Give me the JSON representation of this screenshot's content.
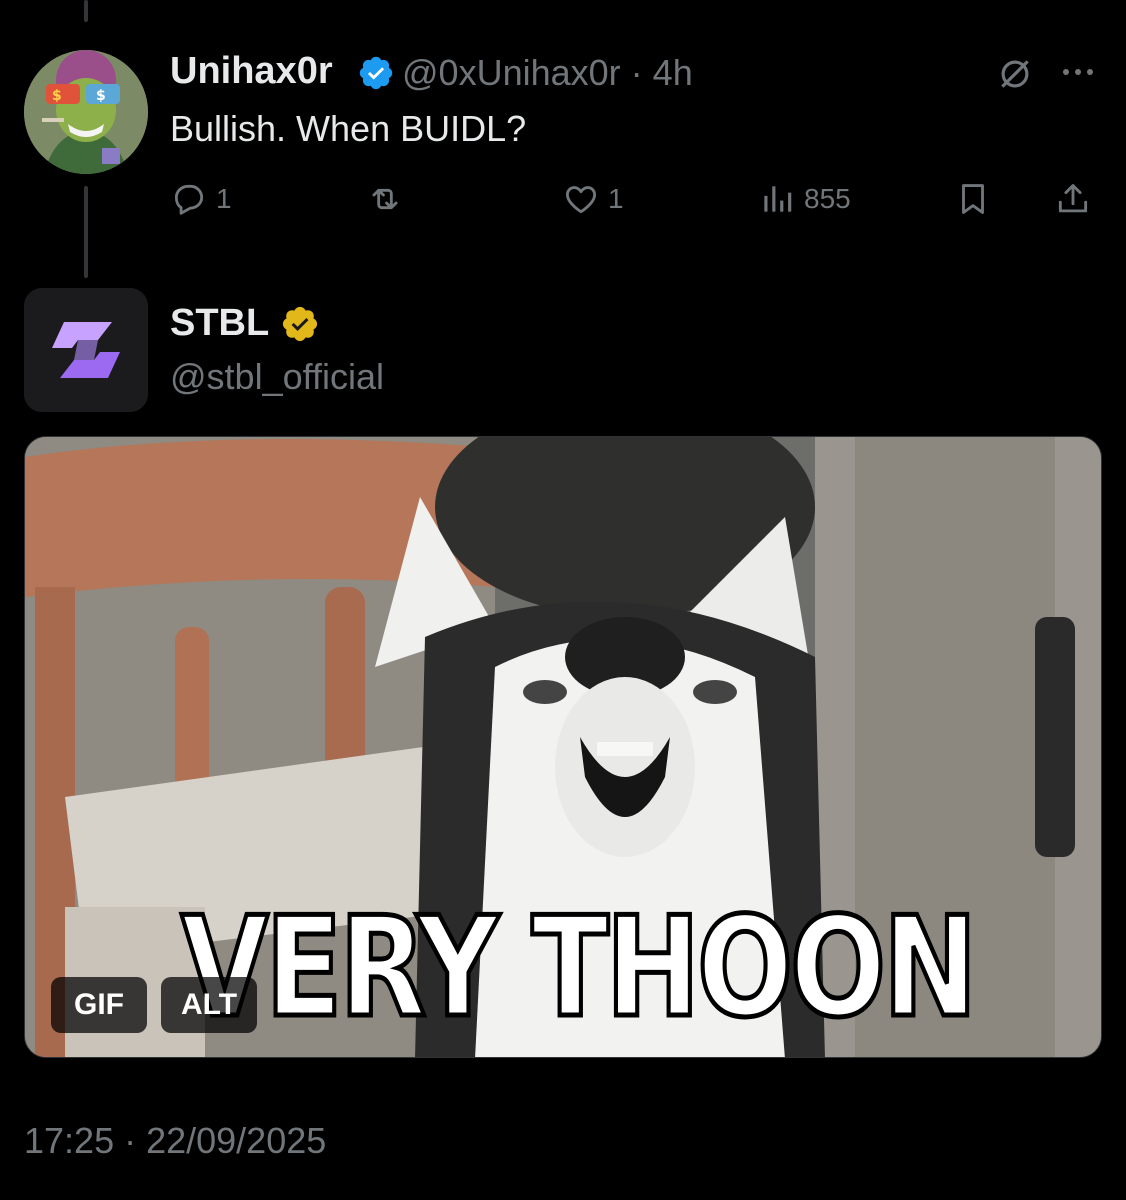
{
  "reply": {
    "display_name": "Unihax0r",
    "handle": "@0xUnihax0r",
    "time": "4h",
    "separator": "·",
    "text": "Bullish. When BUIDL?",
    "stats": {
      "replies": "1",
      "reposts": "",
      "likes": "1",
      "views": "855"
    }
  },
  "main_tweet": {
    "display_name": "STBL",
    "handle": "@stbl_official",
    "media": {
      "caption": "VERY THOON",
      "gif_badge": "GIF",
      "alt_badge": "ALT"
    },
    "timestamp": "17:25 · 22/09/2025"
  },
  "colors": {
    "background": "#000000",
    "text": "#e7e9ea",
    "muted": "#71767b",
    "blue_check": "#1d9bf0",
    "gold_check": "#e2b719",
    "logo_purple": "#b48cff"
  },
  "icons": [
    "verified-badge-icon",
    "mute-icon",
    "more-icon",
    "reply-icon",
    "repost-icon",
    "like-icon",
    "views-icon",
    "bookmark-icon",
    "share-icon",
    "gold-verified-badge-icon",
    "stbl-logo-icon"
  ]
}
